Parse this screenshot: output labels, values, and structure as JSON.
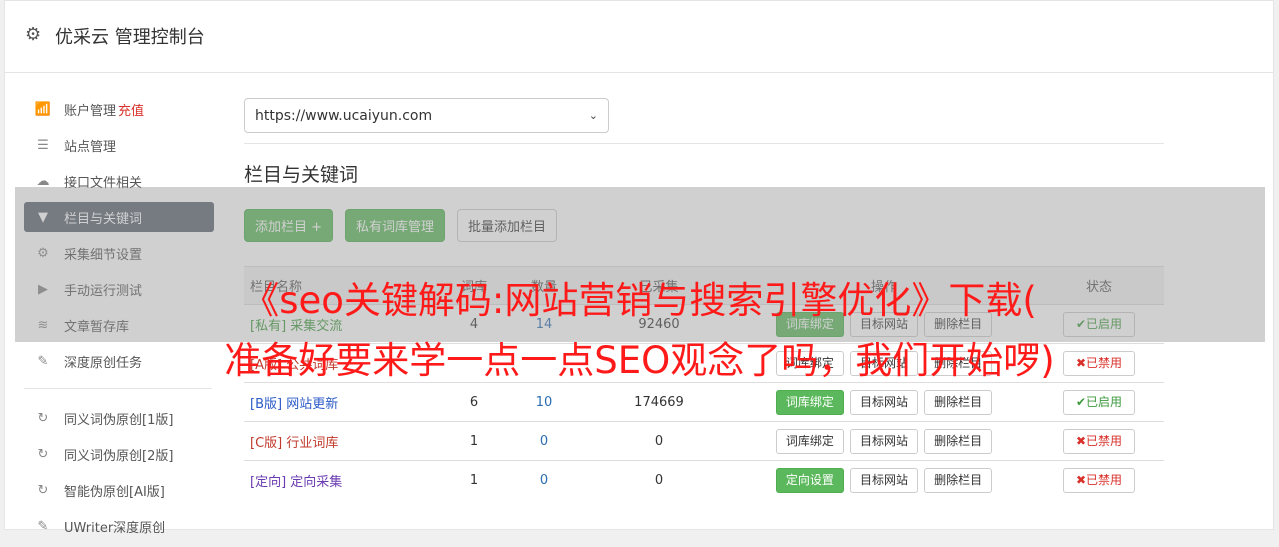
{
  "header": {
    "title": "优采云 管理控制台",
    "icon": "gear-icon"
  },
  "sidebar": {
    "items": [
      {
        "label": "账户管理",
        "extra": "充值",
        "icon": "bar-chart-icon",
        "glyph": "📶"
      },
      {
        "label": "站点管理",
        "icon": "server-icon",
        "glyph": "☰"
      },
      {
        "label": "接口文件相关",
        "icon": "cloud-upload-icon",
        "glyph": "☁"
      },
      {
        "label": "栏目与关键词",
        "icon": "filter-icon",
        "glyph": "▼",
        "active": true
      },
      {
        "label": "采集细节设置",
        "icon": "cogs-icon",
        "glyph": "⚙"
      },
      {
        "label": "手动运行测试",
        "icon": "play-circle-icon",
        "glyph": "▶"
      },
      {
        "label": "文章暂存库",
        "icon": "database-icon",
        "glyph": "≋"
      },
      {
        "label": "深度原创任务",
        "icon": "edit-icon",
        "glyph": "✎"
      }
    ],
    "items2": [
      {
        "label": "同义词伪原创[1版]",
        "icon": "refresh-icon",
        "glyph": "↻"
      },
      {
        "label": "同义词伪原创[2版]",
        "icon": "refresh-icon",
        "glyph": "↻"
      },
      {
        "label": "智能伪原创[AI版]",
        "icon": "refresh-icon",
        "glyph": "↻"
      },
      {
        "label": "UWriter深度原创",
        "icon": "edit-icon",
        "glyph": "✎"
      }
    ]
  },
  "main": {
    "site_select": "https://www.ucaiyun.com",
    "section_title": "栏目与关键词",
    "buttons": {
      "add_column": "添加栏目 +",
      "private_lib": "私有词库管理",
      "batch_add": "批量添加栏目"
    },
    "table": {
      "headers": [
        "栏目名称",
        "词库",
        "数量",
        "已采集",
        "操作",
        "状态"
      ],
      "rows": [
        {
          "tag": "[私有]",
          "name": "采集交流",
          "c1": "4",
          "c2": "14",
          "c3": "92460",
          "action": "词库绑定",
          "action_green": true,
          "status": "✔已启用",
          "on": true,
          "tagcls": "tag-green"
        },
        {
          "tag": "[A版]",
          "name": "公共词库",
          "c1": "",
          "c2": "",
          "c3": "",
          "action": "词库绑定",
          "action_green": false,
          "status": "✖已禁用",
          "on": false,
          "tagcls": "tag-red"
        },
        {
          "tag": "[B版]",
          "name": "网站更新",
          "c1": "6",
          "c2": "10",
          "c3": "174669",
          "action": "词库绑定",
          "action_green": true,
          "status": "✔已启用",
          "on": true,
          "tagcls": "tag-blue"
        },
        {
          "tag": "[C版]",
          "name": "行业词库",
          "c1": "1",
          "c2": "0",
          "c3": "0",
          "action": "词库绑定",
          "action_green": false,
          "status": "✖已禁用",
          "on": false,
          "tagcls": "tag-red"
        },
        {
          "tag": "[定向]",
          "name": "定向采集",
          "c1": "1",
          "c2": "0",
          "c3": "0",
          "action": "定向设置",
          "action_green": true,
          "status": "✖已禁用",
          "on": false,
          "tagcls": "tag-purple"
        }
      ],
      "target_btn": "目标网站",
      "delete_btn": "删除栏目"
    }
  },
  "overlay": {
    "line1": "《seo关键解码:网站营销与搜索引擎优化》下载(",
    "line2": "准备好要来学一点一点SEO观念了吗，我们开始啰)"
  }
}
